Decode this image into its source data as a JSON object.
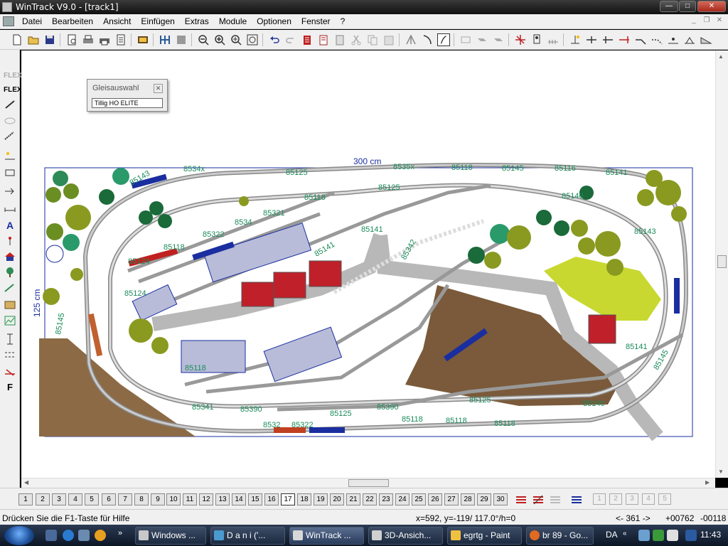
{
  "window": {
    "title": "WinTrack  V9.0 - [track1]",
    "buttons": [
      "minimize",
      "maximize",
      "close"
    ]
  },
  "menu": {
    "items": [
      "Datei",
      "Bearbeiten",
      "Ansicht",
      "Einfügen",
      "Extras",
      "Module",
      "Optionen",
      "Fenster",
      "?"
    ]
  },
  "panel": {
    "title": "Gleisauswahl",
    "select_value": "Tillig HO ELITE"
  },
  "layout": {
    "width_label": "300 cm",
    "height_label": "125 cm",
    "track_labels": [
      "8534x",
      "85125",
      "8535x",
      "85118",
      "85145",
      "85116",
      "85141",
      "85143",
      "85125",
      "85118",
      "85140",
      "8534",
      "85321",
      "85124",
      "85322",
      "85118",
      "85124",
      "85118",
      "85141",
      "85143",
      "85342",
      "85141",
      "85141",
      "85145",
      "85390",
      "85341",
      "85140",
      "85125",
      "85118",
      "85118",
      "85125",
      "85390",
      "85145",
      "8532",
      "85322",
      "85118"
    ]
  },
  "modules": {
    "buttons": [
      "1",
      "2",
      "3",
      "4",
      "5",
      "6",
      "7",
      "8",
      "9",
      "10",
      "11",
      "12",
      "13",
      "14",
      "15",
      "16",
      "17",
      "18",
      "19",
      "20",
      "21",
      "22",
      "23",
      "24",
      "25",
      "26",
      "27",
      "28",
      "29",
      "30"
    ],
    "active": "17",
    "layers": [
      "1",
      "2",
      "3",
      "4",
      "5"
    ]
  },
  "status": {
    "help": "Drücken Sie die  F1-Taste für Hilfe",
    "coords": "x=592, y=-119/ 117.0°/h=0",
    "angle": "<- 361 ->",
    "pos1": "+00762",
    "pos2": "-00118"
  },
  "taskbar": {
    "tasks": [
      "Windows ...",
      "D a n i ('...",
      "WinTrack ...",
      "3D-Ansich...",
      "egrtg - Paint",
      "br 89 - Go..."
    ],
    "language": "DA",
    "clock": "11:43"
  },
  "colors": {
    "track_label": "#1a8a5a",
    "frame": "#1a2ea0",
    "ground_brown": "#8b6a45",
    "road_gray": "#b8b8b8",
    "building_red": "#c0202a"
  }
}
